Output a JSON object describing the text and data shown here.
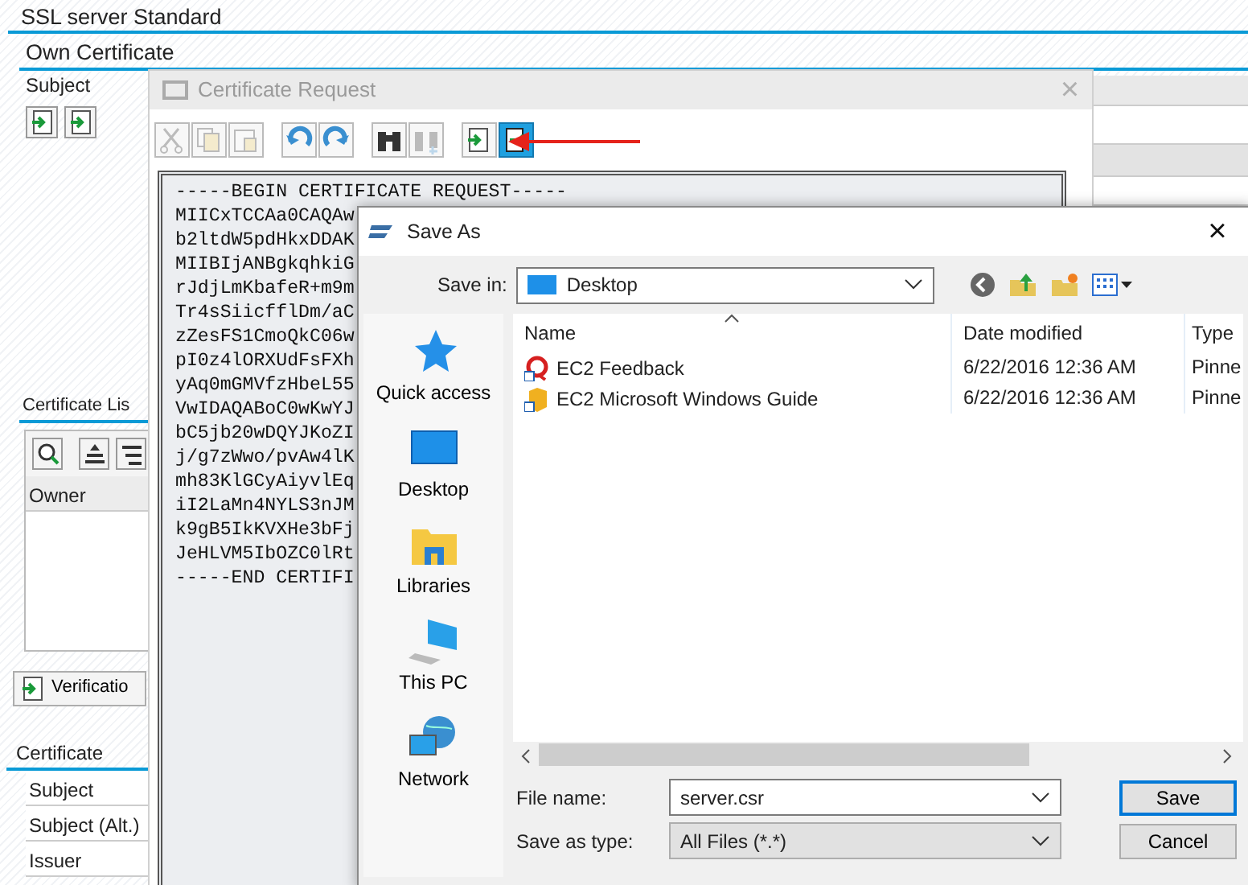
{
  "app": {
    "title": "SSL server Standard",
    "section": "Own Certificate",
    "subject_label": "Subject",
    "certificate_list": {
      "title": "Certificate Lis",
      "column": "Owner"
    },
    "verification_button": "Verificatio",
    "certificate": {
      "title": "Certificate",
      "rows": [
        "Subject",
        "Subject (Alt.)",
        "Issuer"
      ]
    }
  },
  "certificate_request": {
    "title": "Certificate Request",
    "close": "×",
    "active": false,
    "tools": [
      {
        "kind": "cut",
        "disabled": true,
        "selected": false
      },
      {
        "kind": "copy",
        "disabled": true,
        "selected": false
      },
      {
        "kind": "paste",
        "disabled": true,
        "selected": false
      },
      {
        "kind": "undo",
        "disabled": false,
        "selected": false
      },
      {
        "kind": "redo",
        "disabled": false,
        "selected": false
      },
      {
        "kind": "find",
        "disabled": false,
        "selected": false
      },
      {
        "kind": "find-next",
        "disabled": true,
        "selected": false
      },
      {
        "kind": "import",
        "disabled": false,
        "selected": false
      },
      {
        "kind": "export",
        "disabled": false,
        "selected": true
      }
    ],
    "lines": [
      "-----BEGIN CERTIFICATE REQUEST-----",
      "MIICxTCCAa0CAQAw",
      "b2ltdW5pdHkxDDAK",
      "MIIBIjANBgkqhkiG",
      "rJdjLmKbafeR+m9m",
      "Tr4sSiicfflDm/aC",
      "zZesFS1CmoQkC06w",
      "pI0z4lORXUdFsFXh",
      "yAq0mGMVfzHbeL55",
      "VwIDAQABoC0wKwYJ",
      "bC5jb20wDQYJKoZI",
      "j/g7zWwo/pvAw4lK",
      "mh83KlGCyAiyvlEq",
      "iI2LaMn4NYLS3nJM",
      "k9gB5IkKVXHe3bFj",
      "JeHLVM5IbOZC0lRt",
      "-----END CERTIFI"
    ]
  },
  "save_as": {
    "title": "Save As",
    "close": "×",
    "save_in_label": "Save in:",
    "save_in": "Desktop",
    "places": [
      {
        "label": "Quick access",
        "kind": "quick"
      },
      {
        "label": "Desktop",
        "kind": "desktop"
      },
      {
        "label": "Libraries",
        "kind": "libraries"
      },
      {
        "label": "This PC",
        "kind": "pc"
      },
      {
        "label": "Network",
        "kind": "network"
      }
    ],
    "columns": [
      "Name",
      "Date modified",
      "Type"
    ],
    "files": [
      {
        "name": "EC2 Feedback",
        "kind": "feedback",
        "date": "6/22/2016 12:36 AM",
        "type": "Pinne"
      },
      {
        "name": "EC2 Microsoft Windows Guide",
        "kind": "guide",
        "date": "6/22/2016 12:36 AM",
        "type": "Pinne"
      }
    ],
    "file_name_label": "File name:",
    "file_name": "server.csr",
    "type_label": "Save as type:",
    "file_type": "All Files (*.*)",
    "buttons": [
      "Save",
      "Cancel"
    ]
  }
}
